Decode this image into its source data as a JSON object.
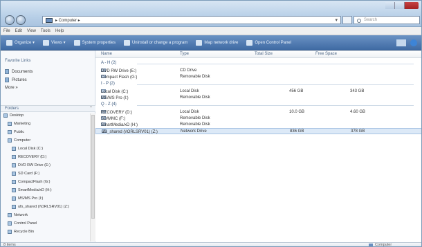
{
  "window": {
    "address": "▸ Computer ▸",
    "search_placeholder": "Search"
  },
  "menu": [
    "File",
    "Edit",
    "View",
    "Tools",
    "Help"
  ],
  "toolbar": [
    "Organize ▾",
    "Views ▾",
    "System properties",
    "Uninstall or change a program",
    "Map network drive",
    "Open Control Panel"
  ],
  "left": {
    "favorites_header": "Favorite Links",
    "favorites": [
      "Documents",
      "Pictures",
      "More »"
    ],
    "folders_header": "Folders",
    "tree": [
      {
        "label": "Desktop",
        "indent": 0
      },
      {
        "label": "Marketing",
        "indent": 1
      },
      {
        "label": "Public",
        "indent": 1
      },
      {
        "label": "Computer",
        "indent": 1
      },
      {
        "label": "Local Disk (C:)",
        "indent": 2
      },
      {
        "label": "RECOVERY (D:)",
        "indent": 2
      },
      {
        "label": "DVD RW Drive (E:)",
        "indent": 2
      },
      {
        "label": "SD Card (F:)",
        "indent": 2
      },
      {
        "label": "CompactFlash (G:)",
        "indent": 2
      },
      {
        "label": "SmartMedia/xD (H:)",
        "indent": 2
      },
      {
        "label": "MS/MS Pro (I:)",
        "indent": 2
      },
      {
        "label": "ufs_shared (\\\\ORLSRV01) (Z:)",
        "indent": 2
      },
      {
        "label": "Network",
        "indent": 1
      },
      {
        "label": "Control Panel",
        "indent": 1
      },
      {
        "label": "Recycle Bin",
        "indent": 1
      }
    ]
  },
  "columns": {
    "name": "Name",
    "type": "Type",
    "total": "Total Size",
    "free": "Free Space"
  },
  "groups": [
    {
      "label": "A - H (2)",
      "rows": [
        {
          "name": "DVD RW Drive (E:)",
          "type": "CD Drive",
          "total": "",
          "free": ""
        },
        {
          "name": "Compact Flash (G:)",
          "type": "Removable Disk",
          "total": "",
          "free": ""
        }
      ]
    },
    {
      "label": "I - P (2)",
      "rows": [
        {
          "name": "Local Disk (C:)",
          "type": "Local Disk",
          "total": "456 GB",
          "free": "343 GB"
        },
        {
          "name": "MS/MS Pro (I:)",
          "type": "Removable Disk",
          "total": "",
          "free": ""
        }
      ]
    },
    {
      "label": "Q - Z (4)",
      "rows": [
        {
          "name": "RECOVERY (D:)",
          "type": "Local Disk",
          "total": "10.0 GB",
          "free": "4.60 GB"
        },
        {
          "name": "SD/MMC (F:)",
          "type": "Removable Disk",
          "total": "",
          "free": ""
        },
        {
          "name": "SmartMedia/xD (H:)",
          "type": "Removable Disk",
          "total": "",
          "free": ""
        },
        {
          "name": "ufs_shared (\\\\ORLSRV01) (Z:)",
          "type": "Network Drive",
          "total": "836 GB",
          "free": "378 GB"
        }
      ]
    }
  ],
  "status": {
    "left": "8 items",
    "right": "Computer"
  }
}
